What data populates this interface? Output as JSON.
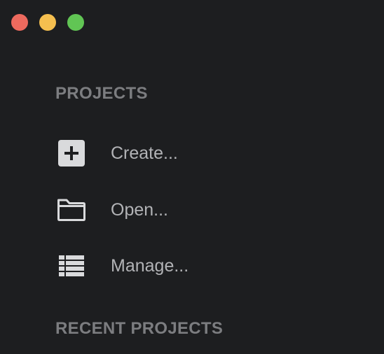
{
  "window": {
    "controls": {
      "close_color": "#ed6a5e",
      "minimize_color": "#f5bf4f",
      "zoom_color": "#61c554"
    }
  },
  "projects": {
    "title": "PROJECTS",
    "items": [
      {
        "label": "Create...",
        "icon": "plus-square-icon"
      },
      {
        "label": "Open...",
        "icon": "folder-icon"
      },
      {
        "label": "Manage...",
        "icon": "list-icon"
      }
    ]
  },
  "recent": {
    "title": "RECENT PROJECTS"
  },
  "colors": {
    "background": "#1d1e20",
    "section_title": "#7c7d80",
    "item_text": "#b2b3b6",
    "icon": "#d9dadc"
  }
}
